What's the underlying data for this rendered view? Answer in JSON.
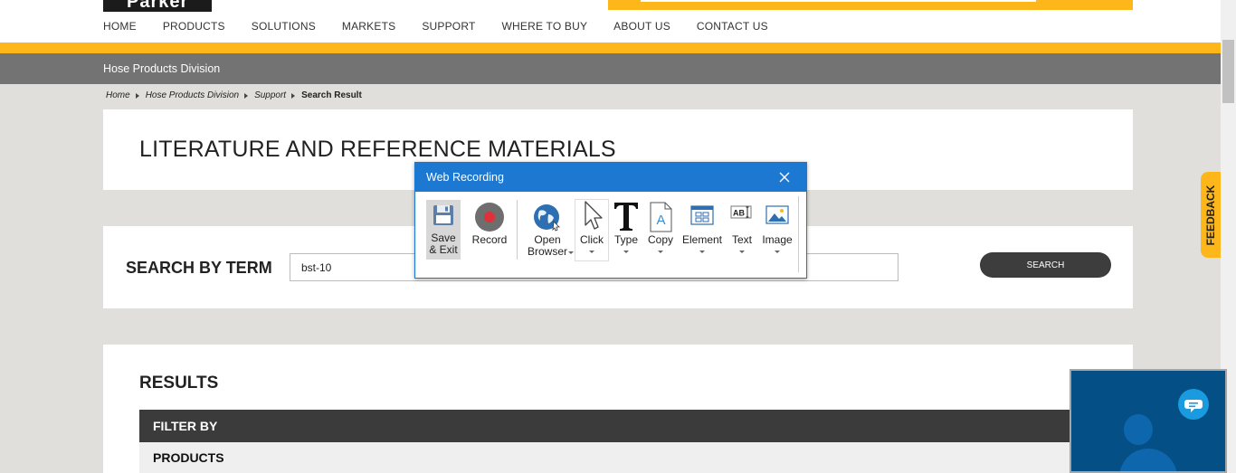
{
  "header": {
    "logo_text": "Parker",
    "nav": [
      "HOME",
      "PRODUCTS",
      "SOLUTIONS",
      "MARKETS",
      "SUPPORT",
      "WHERE TO BUY",
      "ABOUT US",
      "CONTACT US"
    ],
    "division_label": "Hose Products Division"
  },
  "breadcrumb": {
    "items": [
      "Home",
      "Hose Products Division",
      "Support"
    ],
    "current": "Search Result"
  },
  "literature": {
    "title": "LITERATURE AND REFERENCE MATERIALS"
  },
  "search": {
    "label": "SEARCH BY TERM",
    "value": "bst-10",
    "button": "SEARCH"
  },
  "results": {
    "title": "RESULTS",
    "filter_label": "FILTER BY",
    "products_label": "PRODUCTS"
  },
  "feedback": {
    "label": "FEEDBACK"
  },
  "dialog": {
    "title": "Web Recording",
    "tools": {
      "save_line1": "Save",
      "save_line2": "& Exit",
      "record": "Record",
      "open_line1": "Open",
      "open_line2": "Browser",
      "click": "Click",
      "type": "Type",
      "copy": "Copy",
      "element": "Element",
      "text": "Text",
      "image": "Image"
    }
  },
  "colors": {
    "brand_yellow": "#fdb71a",
    "division_gray": "#737373",
    "dialog_blue": "#1c78d0",
    "record_red": "#e0303a",
    "chat_blue": "#044f86"
  }
}
